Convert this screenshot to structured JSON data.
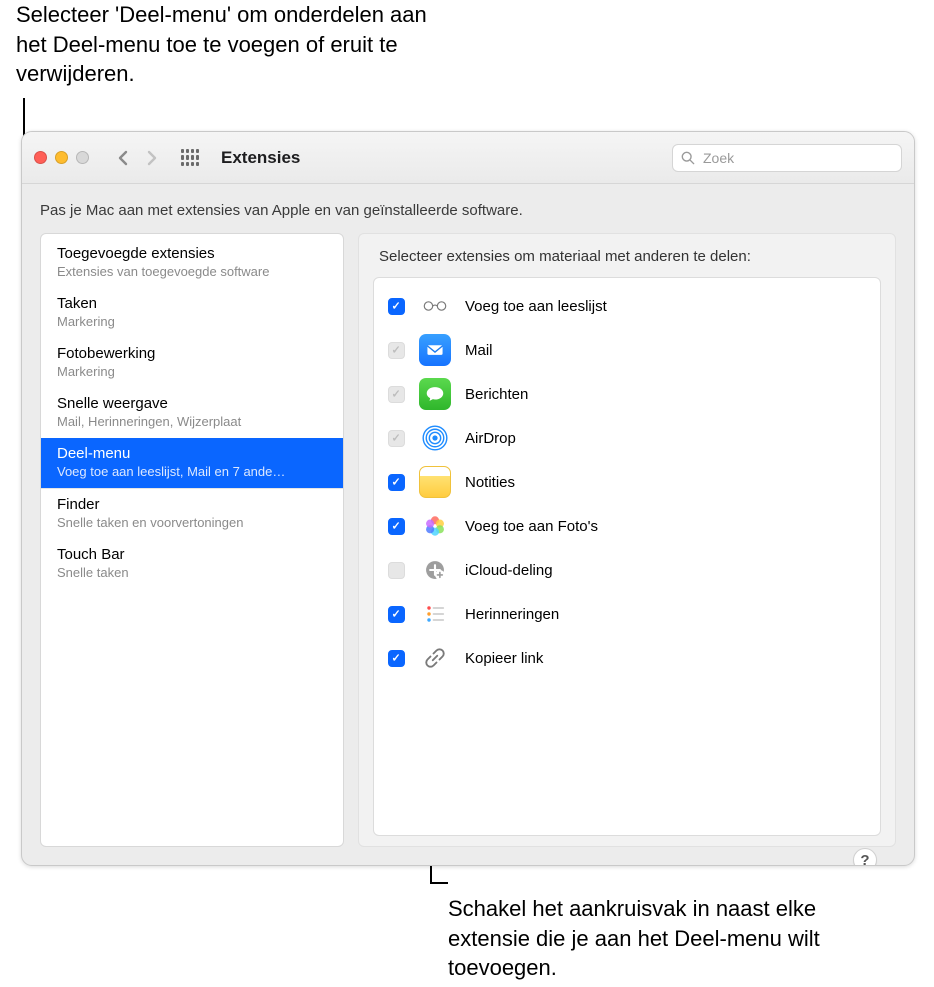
{
  "callouts": {
    "top": "Selecteer 'Deel-menu' om onderdelen aan het Deel-menu toe te voegen of eruit te verwijderen.",
    "bottom": "Schakel het aankruisvak in naast elke extensie die je aan het Deel-menu wilt toevoegen."
  },
  "window": {
    "title": "Extensies",
    "search_placeholder": "Zoek",
    "intro": "Pas je Mac aan met extensies van Apple en van geïnstalleerde software.",
    "help_label": "?"
  },
  "sidebar": [
    {
      "title": "Toegevoegde extensies",
      "sub": "Extensies van toegevoegde software",
      "selected": false
    },
    {
      "title": "Taken",
      "sub": "Markering",
      "selected": false
    },
    {
      "title": "Fotobewerking",
      "sub": "Markering",
      "selected": false
    },
    {
      "title": "Snelle weergave",
      "sub": "Mail, Herinneringen, Wijzerplaat",
      "selected": false
    },
    {
      "title": "Deel-menu",
      "sub": "Voeg toe aan leeslijst, Mail en 7 ande…",
      "selected": true
    },
    {
      "title": "Finder",
      "sub": "Snelle taken en voorvertoningen",
      "selected": false
    },
    {
      "title": "Touch Bar",
      "sub": "Snelle taken",
      "selected": false
    }
  ],
  "detail": {
    "title": "Selecteer extensies om materiaal met anderen te delen:",
    "items": [
      {
        "label": "Voeg toe aan leeslijst",
        "state": "checked",
        "icon": "glasses"
      },
      {
        "label": "Mail",
        "state": "locked",
        "icon": "mail"
      },
      {
        "label": "Berichten",
        "state": "locked",
        "icon": "messages"
      },
      {
        "label": "AirDrop",
        "state": "locked",
        "icon": "airdrop"
      },
      {
        "label": "Notities",
        "state": "checked",
        "icon": "notes"
      },
      {
        "label": "Voeg toe aan Foto's",
        "state": "checked",
        "icon": "photos"
      },
      {
        "label": "iCloud-deling",
        "state": "empty-locked",
        "icon": "icloud"
      },
      {
        "label": "Herinneringen",
        "state": "checked",
        "icon": "reminders"
      },
      {
        "label": "Kopieer link",
        "state": "checked",
        "icon": "link"
      }
    ]
  }
}
